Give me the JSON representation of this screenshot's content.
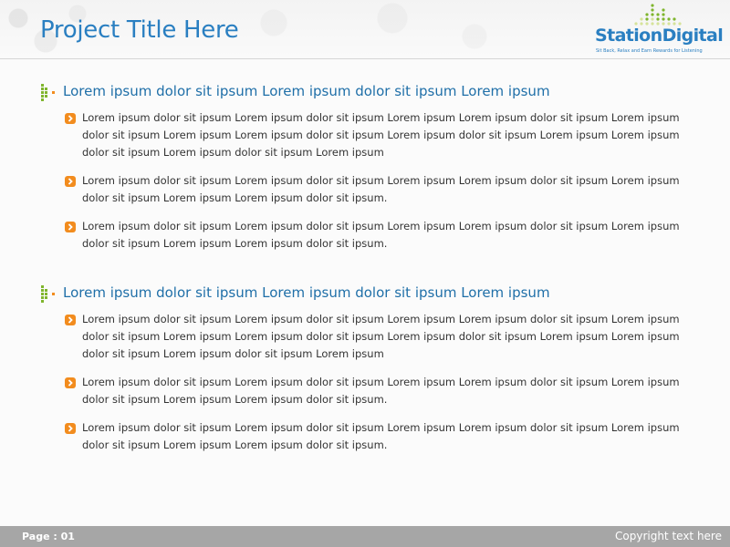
{
  "header": {
    "title": "Project Title Here"
  },
  "logo": {
    "name": "StationDigital",
    "tagline": "Sit Back, Relax and Earn Rewards for Listening",
    "colors": {
      "text": "#2a7fc1",
      "dots_dark": "#7fb52d",
      "dots_light": "#d6e39a"
    }
  },
  "sections": [
    {
      "title": "Lorem ipsum dolor sit ipsum Lorem ipsum dolor sit ipsum Lorem ipsum",
      "icon": "green-orange-dots-icon",
      "bullets": [
        "Lorem ipsum dolor sit ipsum Lorem ipsum dolor sit ipsum Lorem ipsum  Lorem ipsum dolor  sit ipsum Lorem ipsum dolor sit ipsum Lorem ipsum Lorem ipsum dolor sit ipsum Lorem ipsum dolor sit ipsum Lorem ipsum  Lorem ipsum dolor  sit ipsum Lorem ipsum dolor sit ipsum Lorem ipsum",
        "Lorem ipsum dolor sit ipsum Lorem ipsum dolor sit ipsum Lorem ipsum  Lorem ipsum dolor  sit ipsum Lorem ipsum dolor sit ipsum Lorem ipsum Lorem ipsum dolor sit ipsum.",
        "Lorem ipsum dolor sit ipsum Lorem ipsum dolor sit ipsum Lorem ipsum  Lorem ipsum dolor  sit ipsum Lorem ipsum dolor sit ipsum Lorem ipsum Lorem ipsum dolor sit ipsum."
      ]
    },
    {
      "title": "Lorem ipsum dolor sit ipsum Lorem ipsum dolor sit ipsum Lorem ipsum",
      "icon": "green-orange-dots-icon",
      "bullets": [
        "Lorem ipsum dolor sit ipsum Lorem ipsum dolor sit ipsum Lorem ipsum  Lorem ipsum dolor  sit ipsum Lorem ipsum dolor sit ipsum Lorem ipsum Lorem ipsum dolor sit ipsum Lorem ipsum dolor sit ipsum Lorem ipsum  Lorem ipsum dolor  sit ipsum Lorem ipsum dolor sit ipsum Lorem ipsum",
        "Lorem ipsum dolor sit ipsum Lorem ipsum dolor sit ipsum Lorem ipsum  Lorem ipsum dolor  sit ipsum Lorem ipsum dolor sit ipsum Lorem ipsum Lorem ipsum dolor sit ipsum.",
        "Lorem ipsum dolor sit ipsum Lorem ipsum dolor sit ipsum Lorem ipsum  Lorem ipsum dolor  sit ipsum Lorem ipsum dolor sit ipsum Lorem ipsum Lorem ipsum dolor sit ipsum."
      ]
    }
  ],
  "footer": {
    "page_label": "Page : 01",
    "copyright": "Copyright text here"
  },
  "colors": {
    "accent_blue": "#2a7fc1",
    "bullet_orange": "#f28c1e",
    "footer_gray": "#a6a6a6"
  }
}
